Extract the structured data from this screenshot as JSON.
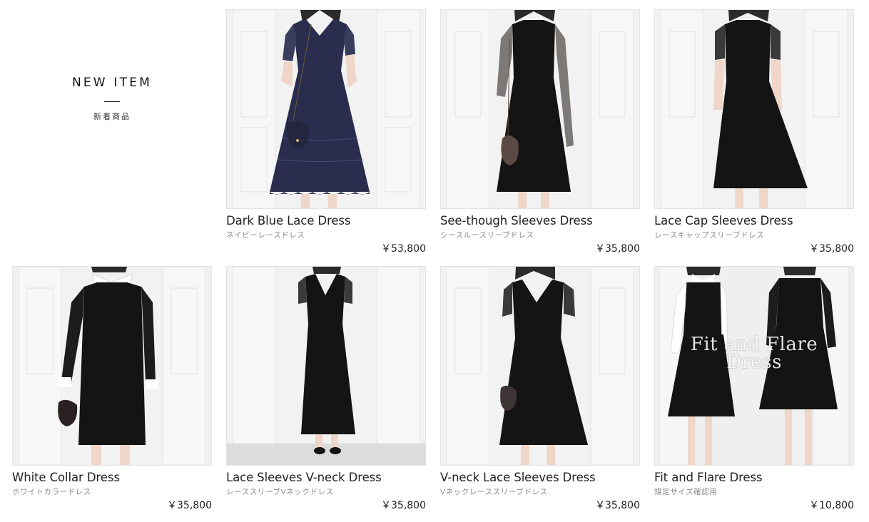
{
  "section": {
    "title": "NEW ITEM",
    "subtitle": "新着商品"
  },
  "products": [
    {
      "name": "Dark Blue Lace Dress",
      "kana": "ネイビーレースドレス",
      "price": "￥53,800",
      "image_icon": "navy-lace-dress-photo"
    },
    {
      "name": "See-though Sleeves Dress",
      "kana": "シースルースリーブドレス",
      "price": "￥35,800",
      "image_icon": "sheer-sleeve-dress-photo"
    },
    {
      "name": "Lace Cap Sleeves Dress",
      "kana": "レースキャップスリーブドレス",
      "price": "￥35,800",
      "image_icon": "lace-cap-sleeve-dress-photo"
    },
    {
      "name": "White Collar Dress",
      "kana": "ホワイトカラードレス",
      "price": "￥35,800",
      "image_icon": "white-collar-dress-photo"
    },
    {
      "name": "Lace Sleeves V-neck Dress",
      "kana": "レーススリーブVネックドレス",
      "price": "￥35,800",
      "image_icon": "lace-vneck-long-dress-photo"
    },
    {
      "name": "V-neck Lace Sleeves Dress",
      "kana": "Vネックレーススリーブドレス",
      "price": "￥35,800",
      "image_icon": "vneck-lace-sleeve-dress-photo"
    },
    {
      "name": "Fit and Flare Dress",
      "kana": "規定サイズ確認用",
      "price": "￥10,800",
      "image_icon": "fit-and-flare-dress-photo",
      "overlay_caption": [
        "Fit and Flare",
        "Dress"
      ]
    }
  ],
  "colors": {
    "dress_black": "#141414",
    "dress_navy": "#2a2d4e",
    "background_wall": "#f1f1f1",
    "skin": "#efd6c8"
  }
}
